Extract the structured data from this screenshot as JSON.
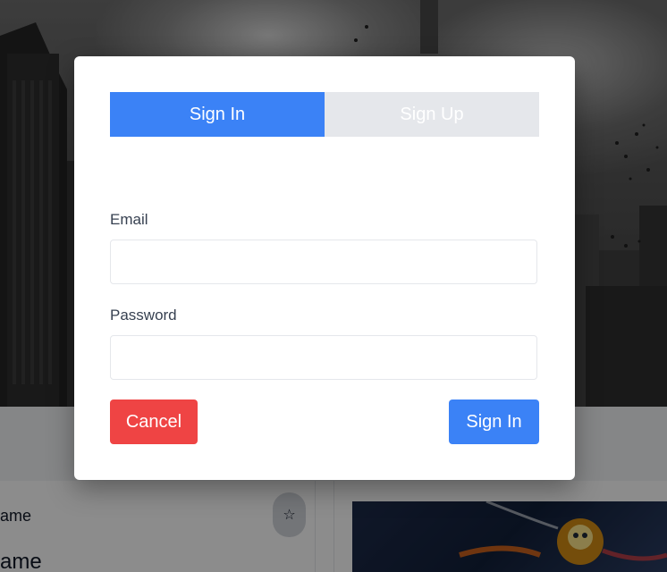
{
  "background": {
    "card_title_small": "ame",
    "card_title_large": "ame",
    "favorite_icon": "star-outline-icon",
    "favorite_glyph": "☆"
  },
  "modal": {
    "tabs": [
      {
        "label": "Sign In",
        "active": true
      },
      {
        "label": "Sign Up",
        "active": false
      }
    ],
    "email": {
      "label": "Email",
      "value": "",
      "placeholder": ""
    },
    "password": {
      "label": "Password",
      "value": "",
      "placeholder": ""
    },
    "cancel_label": "Cancel",
    "submit_label": "Sign In"
  },
  "colors": {
    "primary": "#3b82f6",
    "danger": "#ef4444",
    "tab_inactive": "#e5e7eb"
  }
}
